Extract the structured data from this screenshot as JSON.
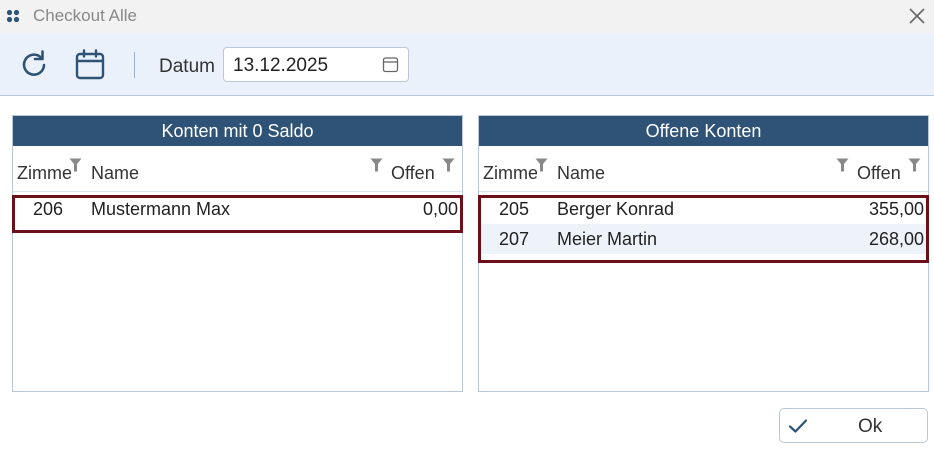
{
  "window": {
    "title": "Checkout Alle"
  },
  "icons": {
    "app": "app-grid-icon",
    "close": "close-icon",
    "refresh": "refresh-icon",
    "calendar": "calendar-icon",
    "filter": "filter-icon",
    "check": "checkmark-icon"
  },
  "colors": {
    "panel_header": "#2f5377",
    "selection": "#6b1018",
    "toolbar_bg": "#eaf1fa",
    "alt_row": "#eef3f9"
  },
  "toolbar": {
    "datum_label": "Datum",
    "date_value": "13.12.2025"
  },
  "left_panel": {
    "title": "Konten mit 0 Saldo",
    "columns": [
      "Zimmer",
      "Name",
      "Offen"
    ],
    "rows": [
      {
        "room": "206",
        "name": "Mustermann Max",
        "open": "0,00"
      }
    ]
  },
  "right_panel": {
    "title": "Offene Konten",
    "columns": [
      "Zimmer",
      "Name",
      "Offen"
    ],
    "rows": [
      {
        "room": "205",
        "name": "Berger Konrad",
        "open": "355,00"
      },
      {
        "room": "207",
        "name": "Meier Martin",
        "open": "268,00"
      }
    ]
  },
  "footer": {
    "ok_label": "Ok"
  }
}
